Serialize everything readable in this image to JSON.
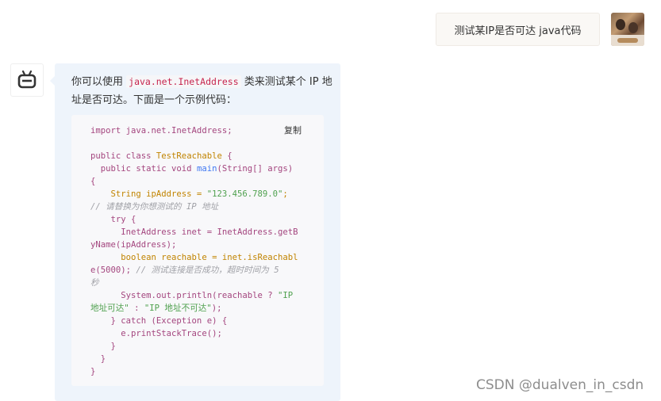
{
  "user_message": {
    "text": "测试某IP是否可达 java代码"
  },
  "bot_message": {
    "intro_before": "你可以使用 ",
    "inline_code": "java.net.InetAddress",
    "intro_after": " 类来测试某个 IP 地址是否可达。下面是一个示例代码：",
    "copy_label": "复制",
    "code_lines": [
      "import java.net.InetAddress;",
      "",
      "public class TestReachable {",
      "  public static void main(String[] args)",
      "{",
      "    String ipAddress = \"123.456.789.0\";",
      "// 请替换为你想测试的 IP 地址",
      "    try {",
      "      InetAddress inet = InetAddress.getB",
      "yName(ipAddress);",
      "      boolean reachable = inet.isReachabl",
      "e(5000); // 测试连接是否成功，超时时间为 5",
      "秒",
      "      System.out.println(reachable ? \"IP",
      "地址可达\" : \"IP 地址不可达\");",
      "    } catch (Exception e) {",
      "      e.printStackTrace();",
      "    }",
      "  }",
      "}"
    ]
  },
  "watermark": "CSDN @dualven_in_csdn",
  "icons": {
    "user_avatar": "user-photo-avatar",
    "bot_avatar": "robot-icon"
  }
}
